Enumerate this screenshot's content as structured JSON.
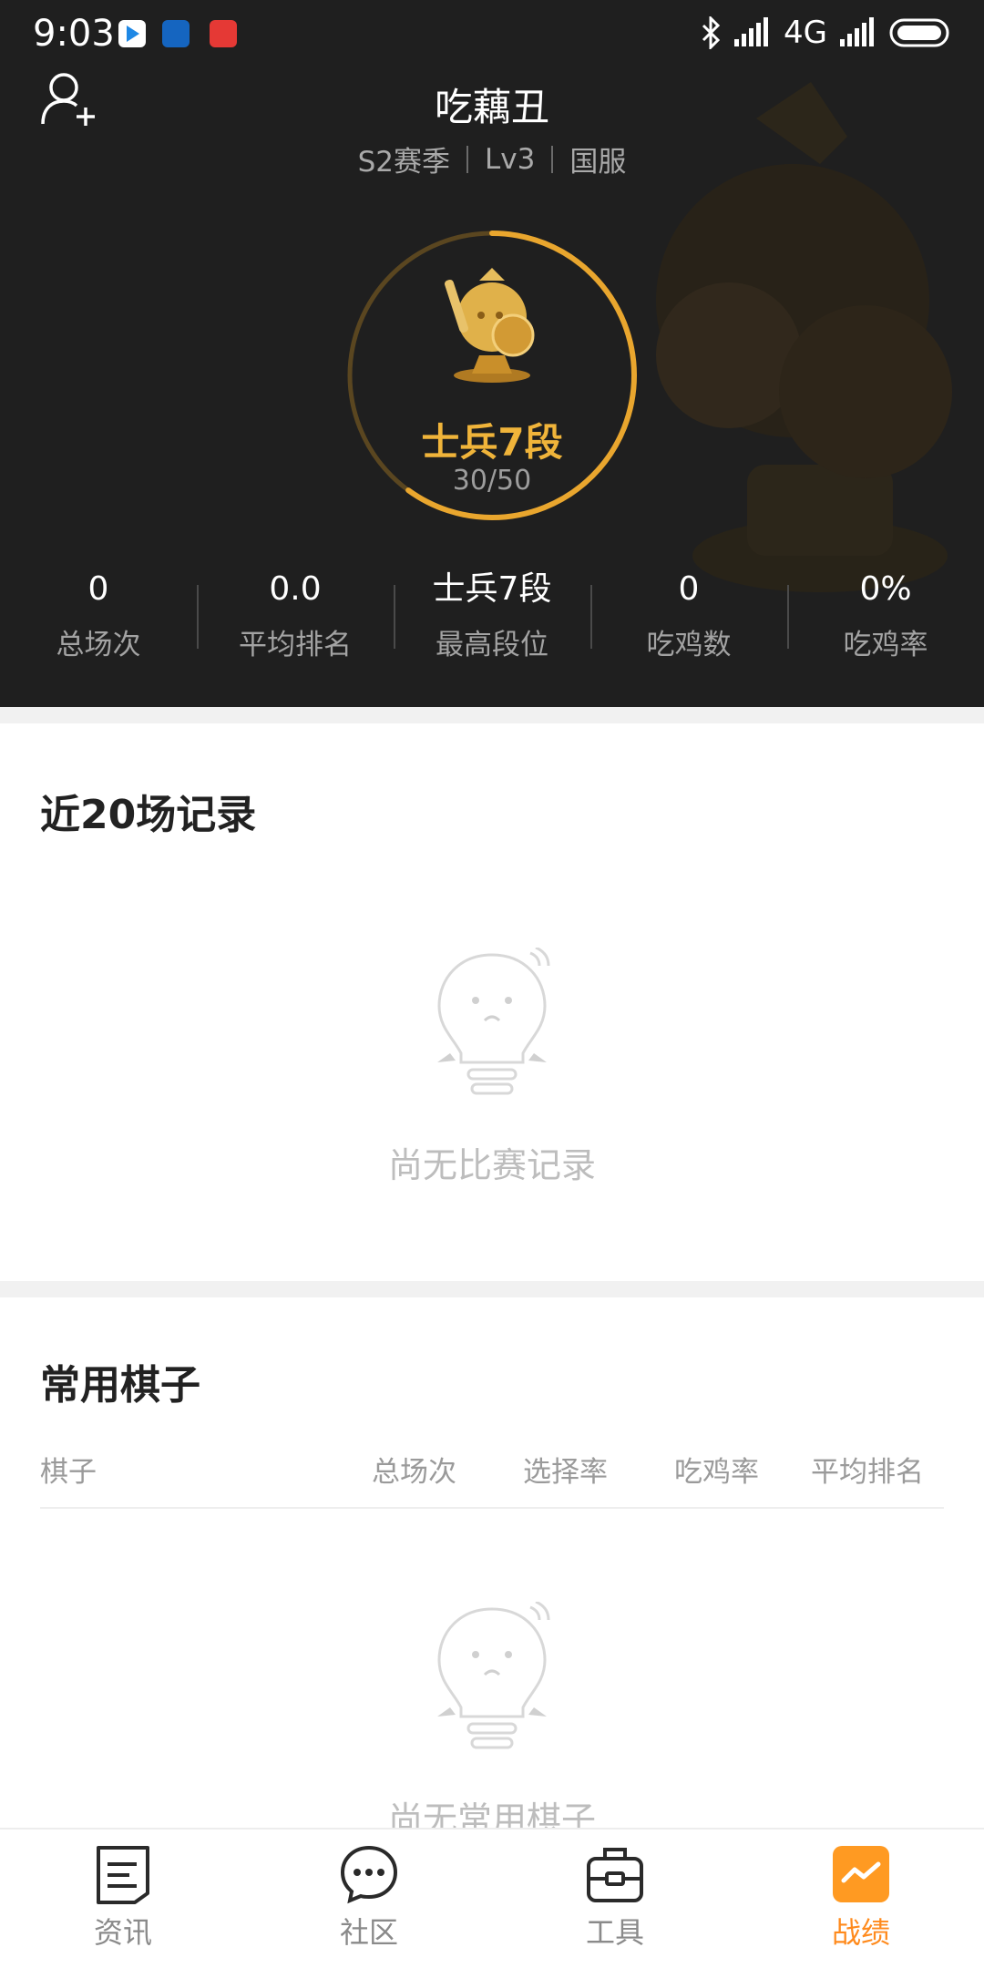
{
  "status_bar": {
    "time": "9:03",
    "network": "4G"
  },
  "profile": {
    "nickname": "吃藕丑",
    "season": "S2赛季",
    "level": "Lv3",
    "server": "国服",
    "rank_name": "士兵7段",
    "rank_progress": "30/50",
    "rank_progress_fraction": 0.6
  },
  "stats": [
    {
      "value": "0",
      "label": "总场次"
    },
    {
      "value": "0.0",
      "label": "平均排名"
    },
    {
      "value": "士兵7段",
      "label": "最高段位"
    },
    {
      "value": "0",
      "label": "吃鸡数"
    },
    {
      "value": "0%",
      "label": "吃鸡率"
    }
  ],
  "recent": {
    "title": "近20场记录",
    "empty_text": "尚无比赛记录"
  },
  "pieces": {
    "title": "常用棋子",
    "columns": [
      "棋子",
      "总场次",
      "选择率",
      "吃鸡率",
      "平均排名"
    ],
    "empty_text": "尚无常用棋子"
  },
  "bottom_nav": [
    {
      "label": "资讯",
      "icon": "news-icon"
    },
    {
      "label": "社区",
      "icon": "chat-bubble-icon"
    },
    {
      "label": "工具",
      "icon": "toolbox-icon"
    },
    {
      "label": "战绩",
      "icon": "stats-chart-icon",
      "active": true
    }
  ],
  "colors": {
    "accent": "#f0b43a",
    "active_tab": "#ff8a1c",
    "header_bg": "#1f1f1f"
  }
}
